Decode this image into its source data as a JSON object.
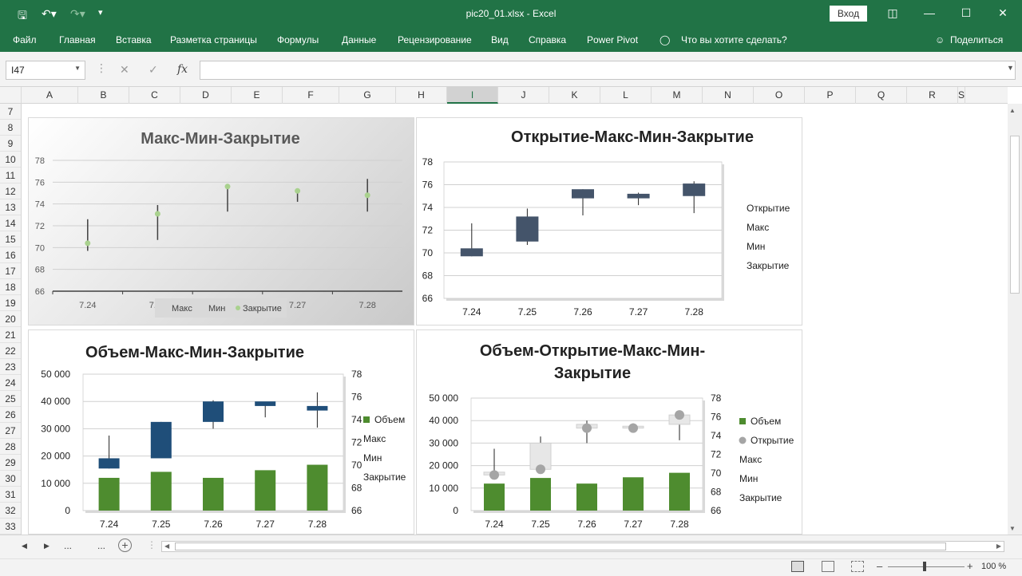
{
  "titlebar": {
    "title": "pic20_01.xlsx  -  Excel",
    "login": "Вход"
  },
  "ribbon": {
    "tabs": [
      "Файл",
      "Главная",
      "Вставка",
      "Разметка страницы",
      "Формулы",
      "Данные",
      "Рецензирование",
      "Вид",
      "Справка",
      "Power Pivot"
    ],
    "search": "Что вы хотите сделать?",
    "share": "Поделиться"
  },
  "formula_bar": {
    "name_box": "I47",
    "fx": "fx",
    "value": ""
  },
  "columns": [
    "A",
    "B",
    "C",
    "D",
    "E",
    "F",
    "G",
    "H",
    "I",
    "J",
    "K",
    "L",
    "M",
    "N",
    "O",
    "P",
    "Q",
    "R",
    "S"
  ],
  "selected_column": "I",
  "rows": [
    "7",
    "8",
    "9",
    "10",
    "11",
    "12",
    "13",
    "14",
    "15",
    "16",
    "17",
    "18",
    "19",
    "20",
    "21",
    "22",
    "23",
    "24",
    "25",
    "26",
    "27",
    "28",
    "29",
    "30",
    "31",
    "32",
    "33"
  ],
  "status": {
    "zoom": "100 %"
  },
  "sheet_nav": {
    "more": "...",
    "more2": "...",
    "add": "+"
  },
  "chart_data": [
    {
      "type": "hlc",
      "title": "Макс-Мин-Закрытие",
      "categories": [
        "7.24",
        "7.25",
        "7.26",
        "7.27",
        "7.28"
      ],
      "series": [
        {
          "name": "Макс",
          "values": [
            72.6,
            73.9,
            75.6,
            75.3,
            76.3
          ]
        },
        {
          "name": "Мин",
          "values": [
            69.7,
            70.7,
            73.3,
            74.2,
            73.3
          ]
        },
        {
          "name": "Закрытие",
          "values": [
            70.4,
            73.1,
            75.6,
            75.2,
            74.8
          ]
        }
      ],
      "ylim": [
        66,
        78
      ],
      "yticks": [
        "66",
        "68",
        "70",
        "72",
        "74",
        "76",
        "78"
      ],
      "legend": [
        "Макс",
        "Мин",
        "Закрытие"
      ]
    },
    {
      "type": "ohlc",
      "title": "Открытие-Макс-Мин-Закрытие",
      "categories": [
        "7.24",
        "7.25",
        "7.26",
        "7.27",
        "7.28"
      ],
      "series": [
        {
          "name": "Открытие",
          "values": [
            70.4,
            73.2,
            75.6,
            75.2,
            76.1
          ]
        },
        {
          "name": "Макс",
          "values": [
            72.6,
            73.9,
            75.6,
            75.3,
            76.3
          ]
        },
        {
          "name": "Мин",
          "values": [
            69.7,
            70.7,
            73.3,
            74.2,
            73.5
          ]
        },
        {
          "name": "Закрытие",
          "values": [
            69.7,
            71.0,
            74.8,
            74.8,
            75.0
          ]
        }
      ],
      "ylim": [
        66,
        78
      ],
      "yticks": [
        "66",
        "68",
        "70",
        "72",
        "74",
        "76",
        "78"
      ],
      "legend": [
        "Открытие",
        "Макс",
        "Мин",
        "Закрытие"
      ]
    },
    {
      "type": "volume-hlc",
      "title": "Объем-Макс-Мин-Закрытие",
      "categories": [
        "7.24",
        "7.25",
        "7.26",
        "7.27",
        "7.28"
      ],
      "series": [
        {
          "name": "Объем",
          "values": [
            12000,
            14200,
            12000,
            14800,
            16800
          ]
        },
        {
          "name": "Макс",
          "values": [
            72.6,
            73.8,
            75.7,
            75.4,
            76.4
          ]
        },
        {
          "name": "Мин",
          "values": [
            69.7,
            70.7,
            73.2,
            74.2,
            73.3
          ]
        },
        {
          "name": "Закрытие",
          "values": [
            70.6,
            73.8,
            75.6,
            75.2,
            74.8
          ]
        }
      ],
      "y_left_ticks": [
        "0",
        "10 000",
        "20 000",
        "30 000",
        "40 000",
        "50 000"
      ],
      "y_right_ticks": [
        "66",
        "68",
        "70",
        "72",
        "74",
        "76",
        "78"
      ],
      "legend": [
        "Объем",
        "Макс",
        "Мин",
        "Закрытие"
      ]
    },
    {
      "type": "volume-ohlc",
      "title": "Объем-Открытие-Макс-Мин-Закрытие",
      "title_lines": [
        "Объем-Открытие-Макс-Мин-",
        "Закрытие"
      ],
      "categories": [
        "7.24",
        "7.25",
        "7.26",
        "7.27",
        "7.28"
      ],
      "series": [
        {
          "name": "Объем",
          "values": [
            12000,
            14500,
            12000,
            14800,
            16800
          ]
        },
        {
          "name": "Открытие",
          "values": [
            69.8,
            70.4,
            74.8,
            74.8,
            76.2
          ]
        },
        {
          "name": "Макс",
          "values": [
            72.6,
            73.9,
            75.6,
            75.3,
            76.3
          ]
        },
        {
          "name": "Мин",
          "values": [
            69.7,
            70.3,
            73.2,
            74.3,
            73.5
          ]
        },
        {
          "name": "Закрытие",
          "values": [
            70.1,
            73.2,
            75.2,
            75.0,
            75.2
          ]
        }
      ],
      "y_left_ticks": [
        "0",
        "10 000",
        "20 000",
        "30 000",
        "40 000",
        "50 000"
      ],
      "y_right_ticks": [
        "66",
        "68",
        "70",
        "72",
        "74",
        "76",
        "78"
      ],
      "legend": [
        "Объем",
        "Открытие",
        "Макс",
        "Мин",
        "Закрытие"
      ]
    }
  ],
  "colors": {
    "excel_green": "#217346",
    "candle": "#44546a",
    "candle_up": "#1f4e79",
    "bar_green": "#4e8c2f",
    "marker": "#a9d18e",
    "grey_marker": "#a5a5a5"
  }
}
